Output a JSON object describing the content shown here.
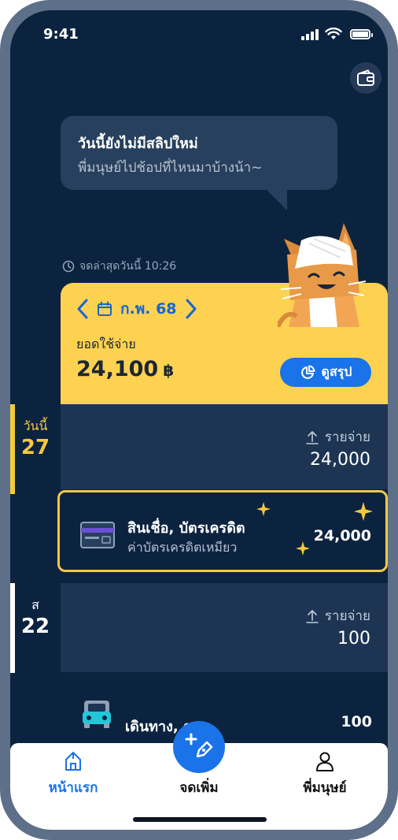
{
  "status_bar": {
    "time": "9:41"
  },
  "speech_bubble": {
    "title": "วันนี้ยังไม่มีสลิปใหม่",
    "subtitle": "พี่มนุษย์ไปช้อปที่ไหนมาบ้างน้า~"
  },
  "last_recorded": "จดล่าสุดวันนี้ 10:26",
  "summary": {
    "month": "ก.พ. 68",
    "spend_label": "ยอดใช้จ่าย",
    "spend_amount": "24,100",
    "currency": "฿",
    "summary_button": "ดูสรุป"
  },
  "days": [
    {
      "day_label": "วันนี้",
      "day_number": "27",
      "kind_label": "รายจ่าย",
      "total": "24,000",
      "accent": "#f4c940",
      "transactions": [
        {
          "title": "สินเชื่อ, บัตรเครดิต",
          "subtitle": "ค่าบัตรเครดิตเหมียว",
          "amount": "24,000",
          "icon": "credit-card-icon"
        }
      ]
    },
    {
      "day_label": "ส",
      "day_number": "22",
      "kind_label": "รายจ่าย",
      "total": "100",
      "accent": "#ffffff",
      "transactions": [
        {
          "title": "เดินทาง, รถ",
          "amount": "100",
          "icon": "car-icon"
        }
      ]
    }
  ],
  "bottom_nav": {
    "home": "หน้าแรก",
    "add": "จดเพิ่ม",
    "profile": "พี่มนุษย์"
  },
  "colors": {
    "background": "#0c2340",
    "card_yellow": "#fcd250",
    "primary_blue": "#1a73e8",
    "highlight_gold": "#f4c940"
  }
}
